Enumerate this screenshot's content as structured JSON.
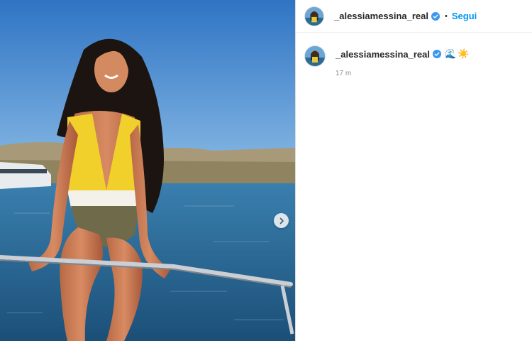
{
  "post": {
    "media_alt": "Woman in a yellow swimsuit sitting on a boat railing by the sea",
    "next_icon": "chevron-right-icon"
  },
  "header": {
    "username": "_alessiamessina_real",
    "verified_icon": "verified-badge-icon",
    "separator": "•",
    "follow_label": "Segui"
  },
  "caption": {
    "username": "_alessiamessina_real",
    "verified_icon": "verified-badge-icon",
    "emoji_1": "🌊",
    "emoji_2": "☀️",
    "time": "17 m"
  },
  "colors": {
    "link_blue": "#0095f6",
    "verified_blue": "#3897f0",
    "sky": "#3f86d2",
    "sea": "#24628f"
  }
}
